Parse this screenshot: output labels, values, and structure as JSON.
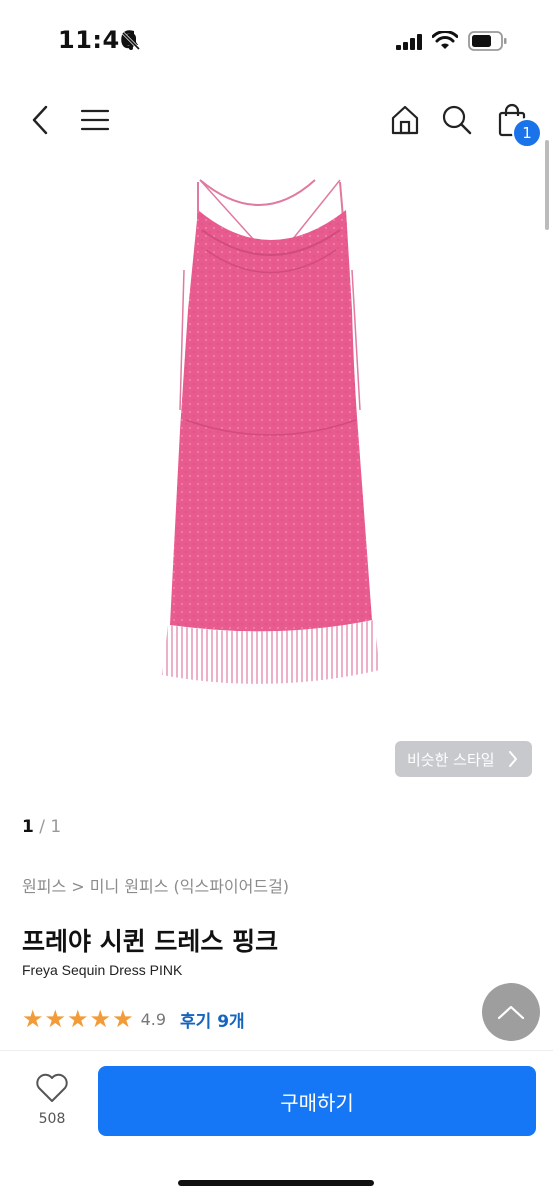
{
  "status_bar": {
    "time": "11:46"
  },
  "topbar": {
    "cart_count": "1"
  },
  "product": {
    "similar_style_label": "비슷한 스타일",
    "pager_current": "1",
    "pager_total": "1",
    "breadcrumb": "원피스 > 미니 원피스 (익스파이어드걸)",
    "title": "프레야 시퀸 드레스 핑크",
    "subtitle": "Freya Sequin Dress PINK",
    "rating": "4.9",
    "stars": 5,
    "review_link": "후기 9개"
  },
  "bottom": {
    "like_count": "508",
    "buy_label": "구매하기"
  },
  "colors": {
    "accent": "#1577f5",
    "star": "#f29b38",
    "dress": "#e85b8e"
  }
}
